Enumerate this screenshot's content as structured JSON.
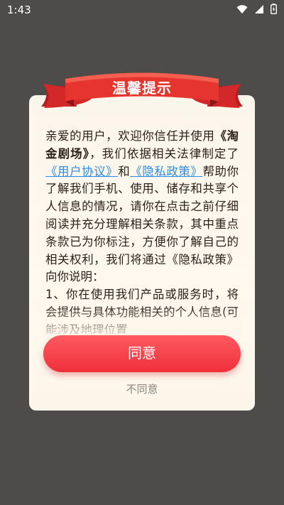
{
  "status_bar": {
    "time": "1:43",
    "icons": [
      "wifi-icon",
      "signal-icon",
      "battery-icon"
    ]
  },
  "dialog": {
    "title": "温馨提示",
    "body": {
      "p1": "亲爱的用户，欢迎你信任并使用",
      "app_name": "《淘金剧场》",
      "p2": "，我们依据相关法律制定了",
      "user_agreement": "《用户协议》",
      "and": "和",
      "privacy_policy": "《隐私政策》",
      "p3": "帮助你了解我们手机、使用、储存和共享个人信息的情况，请你在点击之前仔细阅读并充分理解相关条款，其中重点条款已为你标注，方便你了解自己的相关权利，我们将通过《隐私政策》向你说明：",
      "p4": " 1、你在使用我们产品或服务时，将会提供与具体功能相关的个人信息(可能涉及地理位置"
    },
    "agree_label": "同意",
    "disagree_label": "不同意"
  },
  "colors": {
    "overlay": "#4e4c4b",
    "ribbon_red": "#e3302f",
    "agree_button": "#f2353f",
    "link": "#2f8be6",
    "dialog_bg": "#fbf6ec"
  }
}
